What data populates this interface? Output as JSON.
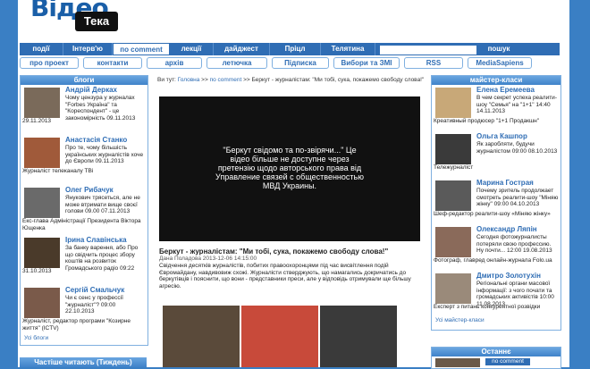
{
  "logo": {
    "text1": "Відео",
    "text2": "Тека"
  },
  "nav_primary": [
    {
      "label": "події",
      "w": 48
    },
    {
      "label": "Інтерв'ю",
      "w": 54
    },
    {
      "label": "по comment",
      "w": 62,
      "active": true
    },
    {
      "label": "лекції",
      "w": 48
    },
    {
      "label": "дайджест",
      "w": 62
    },
    {
      "label": "Пріцл",
      "w": 56
    },
    {
      "label": "Телятина",
      "w": 60
    }
  ],
  "search_button": "пошук",
  "nav_secondary": [
    "про проект",
    "контакти",
    "архів",
    "летючка",
    "Підписка",
    "Вибори та ЗМІ",
    "RSS",
    "MediaSapiens"
  ],
  "blogs": {
    "title": "блоги",
    "items": [
      {
        "name": "Андрій Дерках",
        "text": "Чому цензура у журналах \"Forbes Україна\" та \"Кореспондент\" - це закономірність 09.11.2013",
        "text2": "29.11.2013",
        "photo": "#7a6a5a"
      },
      {
        "name": "Анастасія Станко",
        "text": "Про те, чому більшість українських журналістів хоче до Європи 09.11.2013",
        "text2": "Журналіст телеканалу ТВі",
        "photo": "#a05a3a"
      },
      {
        "name": "Олег Рибачук",
        "text": "Янукович трясеться, але не може втримати вище своєї голови 09.00 07.11.2013",
        "text2": "Екс-глава Адміністрації Президента Віктора Ющенка",
        "photo": "#6a6a6a"
      },
      {
        "name": "Ірина Славінська",
        "text": "За банку варення, або Про що свідчить процес збору коштів на розвиток Громадського радіо 09:22",
        "text2": "31.10.2013",
        "photo": "#4a3a2a"
      },
      {
        "name": "Сергій Смальчук",
        "text": "Чи є сенс у профессії \"журналіст\"? 09:00 22.10.2013",
        "text2": "Журналіст, редактор програми \"Козирне життя\" (ICTV)",
        "photo": "#7a5a4a"
      }
    ],
    "more": "Усі блоги"
  },
  "most_read": "Частіше читають (Тиждень)",
  "breadcrumb": {
    "prefix": "Ви тут:",
    "home": "Головна",
    "section": "по comment",
    "current": "Беркут - журналістам: \"Ми тобі, сука, покажемо свободу слова!\""
  },
  "video_message": "\"Беркут свідомо та по-звірячи...\" Це відео більше не доступне через претензію щодо авторського права від Управление связей с общественностью МВД Украины.",
  "article": {
    "title": "Беркут - журналістам: \"Ми тобі, сука, покажемо свободу слова!\"",
    "meta": "Дана Поладова 2013-12-06 14:15:00",
    "body": "Свідчення десятків журналістів, побитих правоохоронцями під час висвітлення подій Євромайдану, навдивовиж схожі. Журналісти стверджують, що намагались докричатись до беркутівців і пояснити, що вони - представники преси, але у відповідь отримували ще більшу агресію."
  },
  "photos": [
    "#5a4a3a",
    "#c84a3a",
    "#3a3a3a"
  ],
  "masterclass": {
    "title": "майстер-класи",
    "items": [
      {
        "name": "Елена Еремеева",
        "text": "В чем секрет успеха реалити-шоу \"Семья\" на \"1+1\" 14:40 14.11.2013",
        "text2": "Креативный продюсер \"1+1 Продакшн\"",
        "photo": "#c8a878"
      },
      {
        "name": "Ольга Кашпор",
        "text": "Як заробляти, будучи журналістом 09:00 08.10.2013",
        "text2": "Тележурналіст",
        "photo": "#3a3a3a"
      },
      {
        "name": "Марина Гострая",
        "text": "Почему зритель продолжает смотреть реалити-шоу \"Міняю жінку\" 09:00 04.10.2013",
        "text2": "Шеф-редактор реалити-шоу «Міняю жінку»",
        "photo": "#5a5a5a"
      },
      {
        "name": "Олександр Ляпін",
        "text": "Сегодня фотожурналисты потеряли свою профессию. Ну почти... 12:00 19.08.2013",
        "text2": "Фотограф, главред онлайн-журнала Folo.ua",
        "photo": "#8a6a5a"
      },
      {
        "name": "Дмитро Золотухін",
        "text": "Регіональні органи масової інформації: з чого почати та громадських активістів 10:00 11.08.2013",
        "text2": "Експерт з питань конкурентної розвідки",
        "photo": "#9a8a7a"
      }
    ],
    "more": "Усі майстер-класи"
  },
  "latest": {
    "title": "Останнє",
    "tag": "no comment"
  }
}
